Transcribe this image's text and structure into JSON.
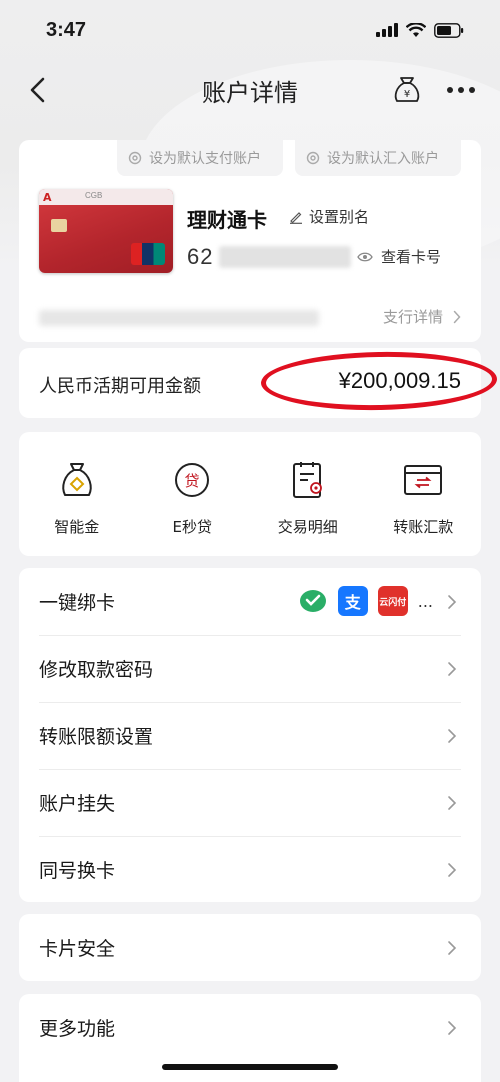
{
  "status_bar": {
    "time": "3:47"
  },
  "nav": {
    "title": "账户详情"
  },
  "account": {
    "set_default_pay": "设为默认支付账户",
    "set_default_receive": "设为默认汇入账户",
    "card_name": "理财通卡",
    "set_alias": "设置别名",
    "card_number_prefix": "62",
    "view_card_number": "查看卡号",
    "branch_detail": "支行详情",
    "card_brand_text": "CGB",
    "card_network": "UnionPay"
  },
  "balance": {
    "label": "人民币活期可用金额",
    "amount": "¥200,009.15",
    "highlight_color": "#e01020"
  },
  "functions": [
    {
      "label": "智能金",
      "icon": "money-bag-icon"
    },
    {
      "label": "E秒贷",
      "icon": "loan-icon"
    },
    {
      "label": "交易明细",
      "icon": "transaction-detail-icon"
    },
    {
      "label": "转账汇款",
      "icon": "transfer-icon"
    }
  ],
  "menu_group1": [
    {
      "label": "一键绑卡"
    },
    {
      "label": "修改取款密码"
    },
    {
      "label": "转账限额设置"
    },
    {
      "label": "账户挂失"
    },
    {
      "label": "同号换卡"
    }
  ],
  "bind_card_more": "...",
  "menu_group2": [
    {
      "label": "卡片安全"
    }
  ],
  "menu_group3": [
    {
      "label": "更多功能"
    }
  ],
  "colors": {
    "accent": "#c0141e",
    "background": "#f2f2f4",
    "wechat": "#2aae67",
    "alipay": "#1677ff",
    "unionpay": "#e0312b"
  }
}
